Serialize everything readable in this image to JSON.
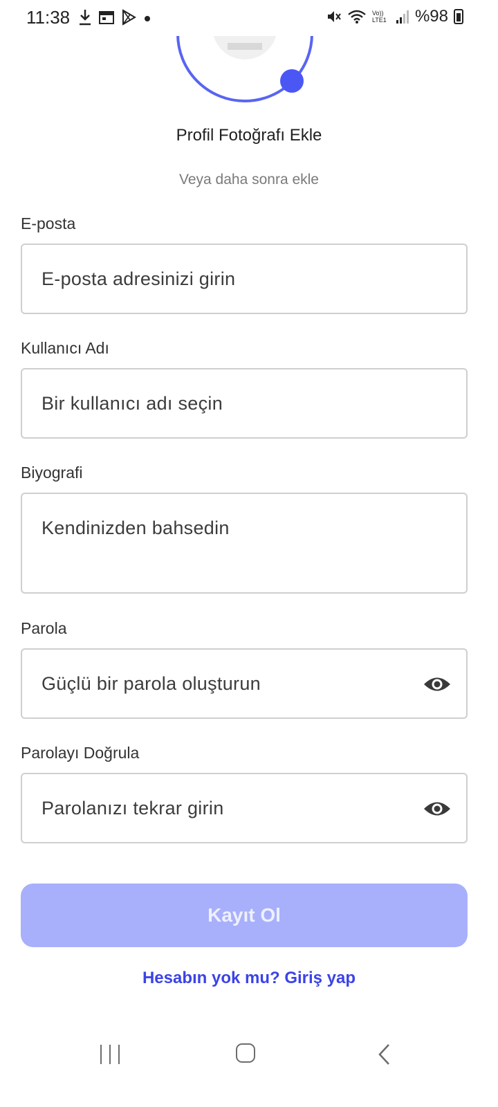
{
  "status_bar": {
    "time": "11:38",
    "battery": "%98",
    "icons_left": [
      "download-icon",
      "calendar-icon",
      "play-store-icon",
      "dot-icon"
    ],
    "icons_right": [
      "mute-icon",
      "wifi-icon",
      "volte-icon",
      "signal-icon",
      "battery-icon"
    ],
    "volte_label": "Vo)) LTE1"
  },
  "profile": {
    "title": "Profil Fotoğrafı Ekle",
    "subtitle": "Veya daha sonra ekle"
  },
  "form": {
    "email": {
      "label": "E-posta",
      "placeholder": "E-posta adresinizi girin"
    },
    "username": {
      "label": "Kullanıcı Adı",
      "placeholder": "Bir kullanıcı adı seçin"
    },
    "bio": {
      "label": "Biyografi",
      "placeholder": "Kendinizden bahsedin"
    },
    "password": {
      "label": "Parola",
      "placeholder": "Güçlü bir parola oluşturun"
    },
    "confirm_password": {
      "label": "Parolayı Doğrula",
      "placeholder": "Parolanızı tekrar girin"
    }
  },
  "submit_label": "Kayıt Ol",
  "login_link": "Hesabın yok mu? Giriş yap",
  "colors": {
    "accent": "#5865f2",
    "button_disabled": "#a8b0fb",
    "link": "#3b43e8"
  }
}
